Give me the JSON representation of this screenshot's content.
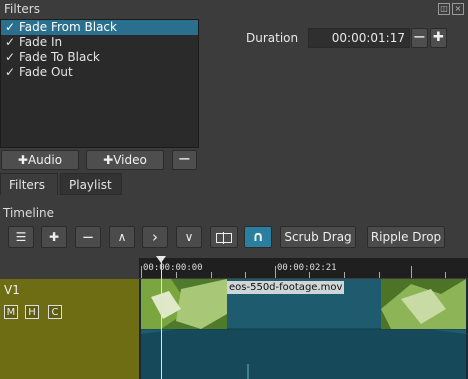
{
  "filters_panel": {
    "title": "Filters",
    "items": [
      {
        "label": "Fade From Black",
        "checked": true,
        "selected": true
      },
      {
        "label": "Fade In",
        "checked": true,
        "selected": false
      },
      {
        "label": "Fade To Black",
        "checked": true,
        "selected": false
      },
      {
        "label": "Fade Out",
        "checked": true,
        "selected": false
      }
    ],
    "check_glyph": "✓",
    "duration_label": "Duration",
    "duration_value": "00:00:01:17",
    "minus_glyph": "−",
    "plus_glyph": "✚",
    "add_audio_label": "Audio",
    "add_video_label": "Video",
    "remove_label": "−"
  },
  "tabs": [
    {
      "label": "Filters",
      "active": true
    },
    {
      "label": "Playlist",
      "active": false
    }
  ],
  "timeline": {
    "title": "Timeline",
    "toolbar": {
      "menu_glyph": "☰",
      "add_glyph": "✚",
      "remove_glyph": "−",
      "lift_glyph": "∧",
      "overwrite_glyph": "›",
      "append_glyph": "∨",
      "scrub_drag_label": "Scrub Drag",
      "ripple_drop_label": "Ripple Drop"
    },
    "ruler": {
      "start_label": "00:00:00:00",
      "mark_label": "00:00:02:21"
    },
    "track": {
      "name": "V1",
      "mute_label": "M",
      "hide_label": "H",
      "composite_label": "C",
      "clip_name": "eos-550d-footage.mov"
    },
    "colors": {
      "track_head": "#6f6d14",
      "clip": "#1f5b6e",
      "selection": "#2a6f8e",
      "snap_active": "#2a7fa0"
    }
  }
}
